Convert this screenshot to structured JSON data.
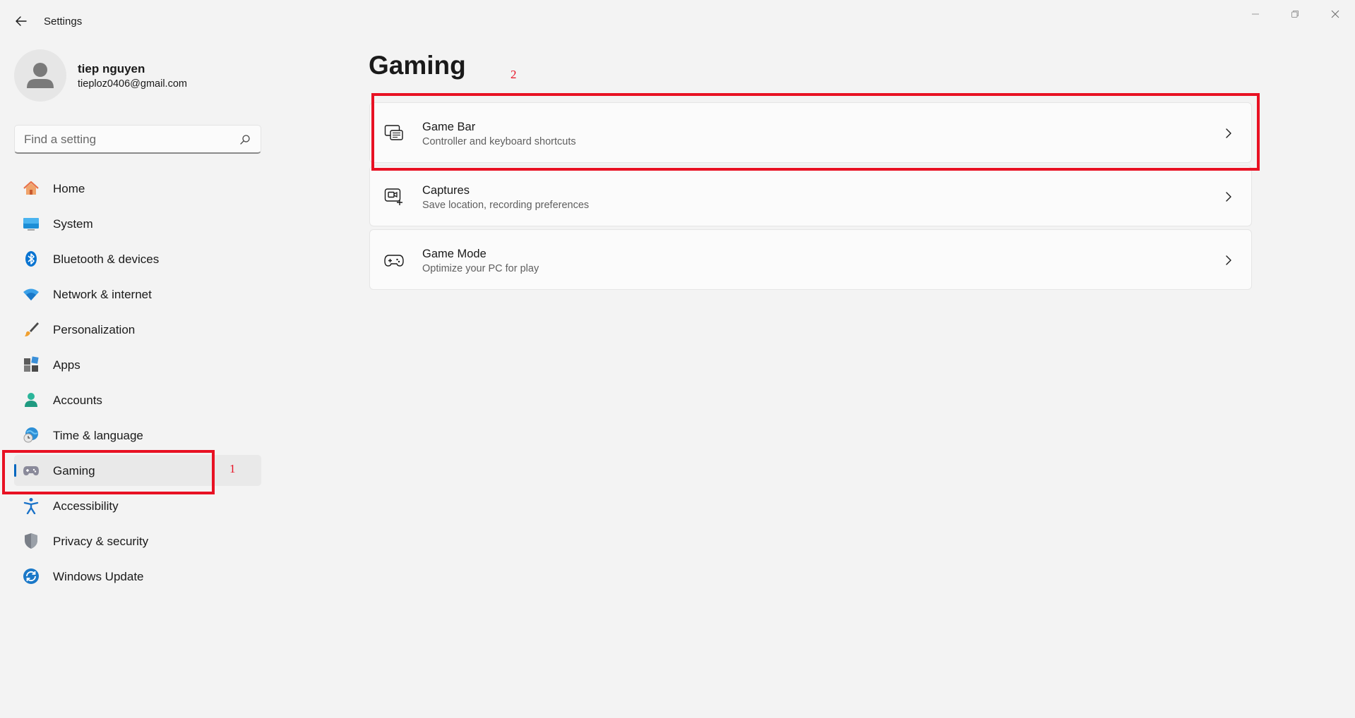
{
  "window": {
    "title": "Settings",
    "back_icon": "arrow-left-icon",
    "minimize_icon": "minimize-icon",
    "restore_icon": "restore-icon",
    "close_icon": "close-icon"
  },
  "profile": {
    "name": "tiep nguyen",
    "email": "tieploz0406@gmail.com"
  },
  "search": {
    "placeholder": "Find a setting",
    "value": ""
  },
  "sidebar": {
    "selected": "Gaming",
    "accent_color": "#0067c0",
    "items": [
      {
        "label": "Home",
        "icon": "home-icon"
      },
      {
        "label": "System",
        "icon": "system-icon"
      },
      {
        "label": "Bluetooth & devices",
        "icon": "bluetooth-icon"
      },
      {
        "label": "Network & internet",
        "icon": "wifi-icon"
      },
      {
        "label": "Personalization",
        "icon": "paintbrush-icon"
      },
      {
        "label": "Apps",
        "icon": "apps-icon"
      },
      {
        "label": "Accounts",
        "icon": "accounts-icon"
      },
      {
        "label": "Time & language",
        "icon": "globe-clock-icon"
      },
      {
        "label": "Gaming",
        "icon": "gamepad-icon"
      },
      {
        "label": "Accessibility",
        "icon": "accessibility-icon"
      },
      {
        "label": "Privacy & security",
        "icon": "shield-icon"
      },
      {
        "label": "Windows Update",
        "icon": "update-icon"
      }
    ]
  },
  "main": {
    "title": "Gaming",
    "cards": [
      {
        "title": "Game Bar",
        "subtitle": "Controller and keyboard shortcuts",
        "icon": "game-bar-icon"
      },
      {
        "title": "Captures",
        "subtitle": "Save location, recording preferences",
        "icon": "capture-icon"
      },
      {
        "title": "Game Mode",
        "subtitle": "Optimize your PC for play",
        "icon": "game-mode-icon"
      }
    ]
  },
  "annotations": {
    "color": "#e81123",
    "labels": [
      "1",
      "2"
    ]
  }
}
